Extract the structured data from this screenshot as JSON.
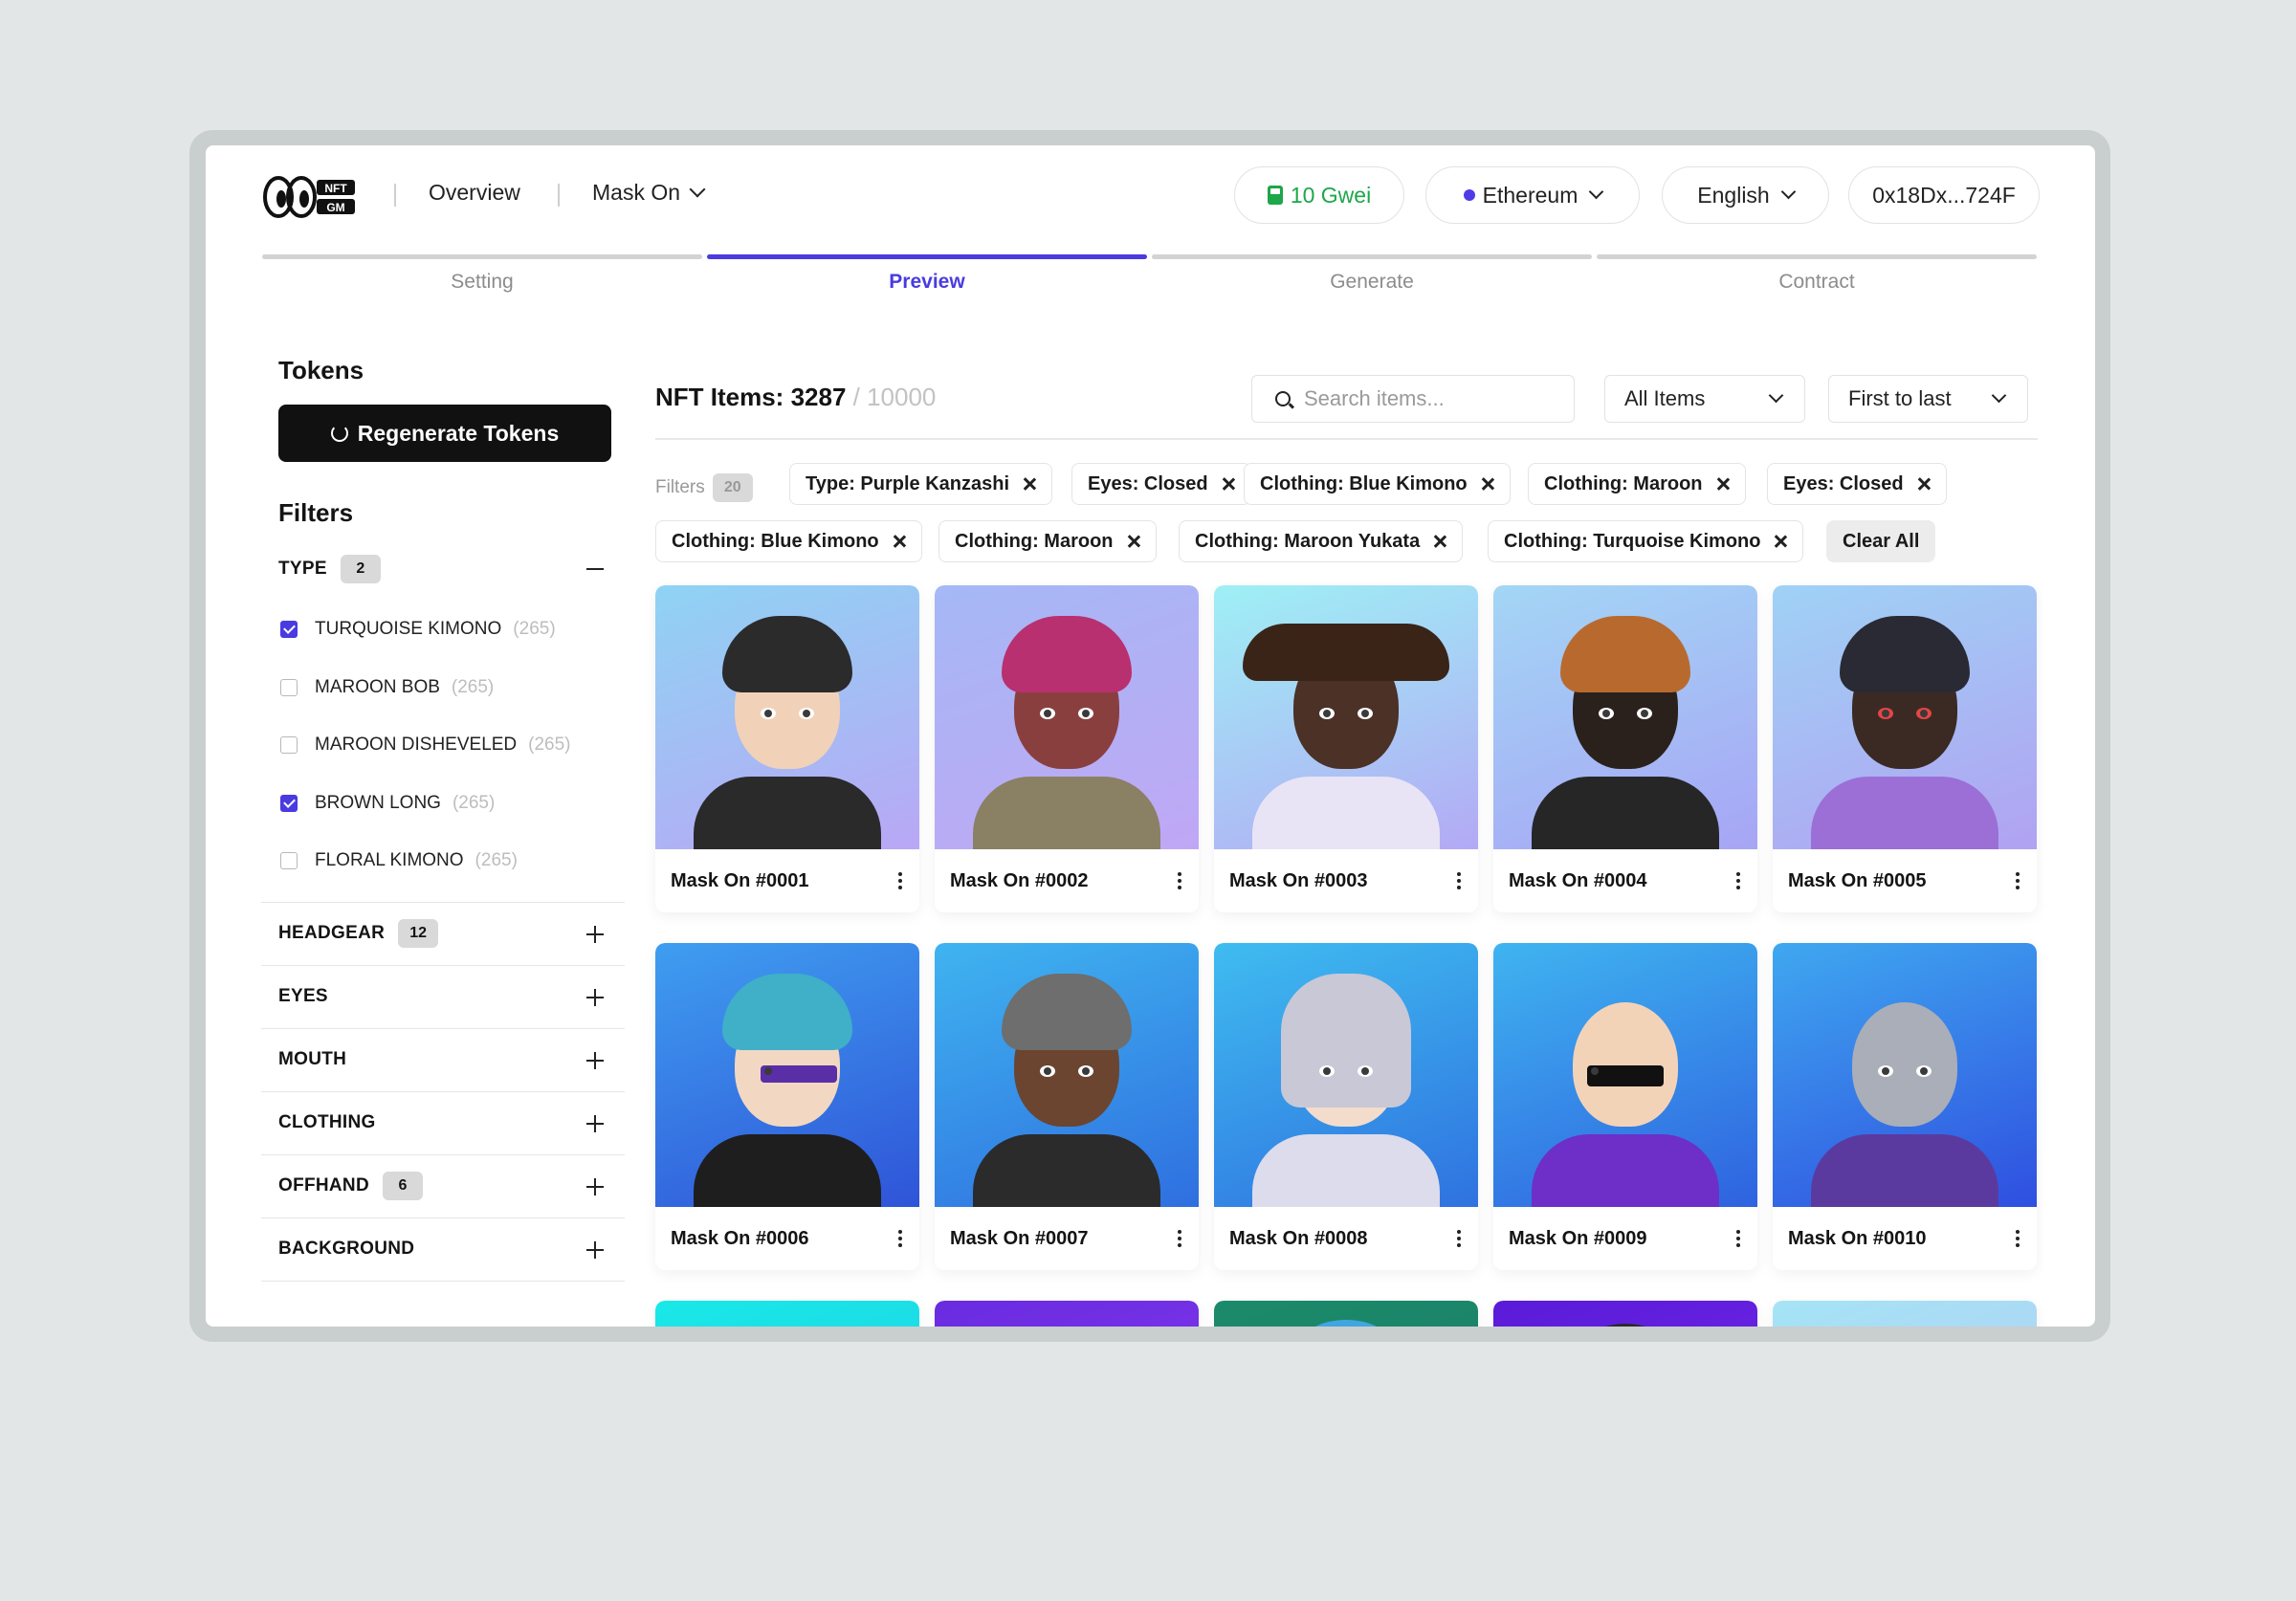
{
  "colors": {
    "accent": "#4a3be0",
    "gas": "#1ca74a"
  },
  "header": {
    "logo_text": "NFT GM",
    "nav": {
      "overview": "Overview",
      "project": "Mask On"
    },
    "gas": "10 Gwei",
    "network": "Ethereum",
    "language": "English",
    "wallet": "0x18Dx...724F"
  },
  "steps": [
    {
      "label": "Setting",
      "active": false
    },
    {
      "label": "Preview",
      "active": true
    },
    {
      "label": "Generate",
      "active": false
    },
    {
      "label": "Contract",
      "active": false
    }
  ],
  "sidebar": {
    "tokens_title": "Tokens",
    "regenerate_label": "Regenerate Tokens",
    "filters_title": "Filters",
    "type": {
      "name": "TYPE",
      "count": "2",
      "options": [
        {
          "label": "TURQUOISE KIMONO",
          "count": "(265)",
          "checked": true
        },
        {
          "label": "MAROON BOB",
          "count": "(265)",
          "checked": false
        },
        {
          "label": "MAROON DISHEVELED",
          "count": "(265)",
          "checked": false
        },
        {
          "label": "BROWN LONG",
          "count": "(265)",
          "checked": true
        },
        {
          "label": "FLORAL KIMONO",
          "count": "(265)",
          "checked": false
        }
      ]
    },
    "categories": [
      {
        "name": "HEADGEAR",
        "count": "12"
      },
      {
        "name": "EYES",
        "count": ""
      },
      {
        "name": "MOUTH",
        "count": ""
      },
      {
        "name": "CLOTHING",
        "count": ""
      },
      {
        "name": "OFFHAND",
        "count": "6"
      },
      {
        "name": "BACKGROUND",
        "count": ""
      }
    ]
  },
  "main": {
    "items_label": "NFT Items: 3287",
    "items_total": "/ 10000",
    "search_placeholder": "Search items...",
    "filter_select": "All Items",
    "sort_select": "First to last",
    "filters_label": "Filters",
    "filters_count": "20",
    "chips": [
      "Type: Purple Kanzashi",
      "Eyes: Closed",
      "Clothing: Blue Kimono",
      "Clothing: Maroon",
      "Eyes: Closed",
      "Clothing: Blue Kimono",
      "Clothing: Maroon",
      "Clothing: Maroon Yukata",
      "Clothing: Turquoise Kimono"
    ],
    "clear_all": "Clear All",
    "cards": [
      {
        "name": "Mask On #0001"
      },
      {
        "name": "Mask On #0002"
      },
      {
        "name": "Mask On #0003"
      },
      {
        "name": "Mask On #0004"
      },
      {
        "name": "Mask On #0005"
      },
      {
        "name": "Mask On #0006"
      },
      {
        "name": "Mask On #0007"
      },
      {
        "name": "Mask On #0008"
      },
      {
        "name": "Mask On #0009"
      },
      {
        "name": "Mask On #0010"
      }
    ]
  }
}
